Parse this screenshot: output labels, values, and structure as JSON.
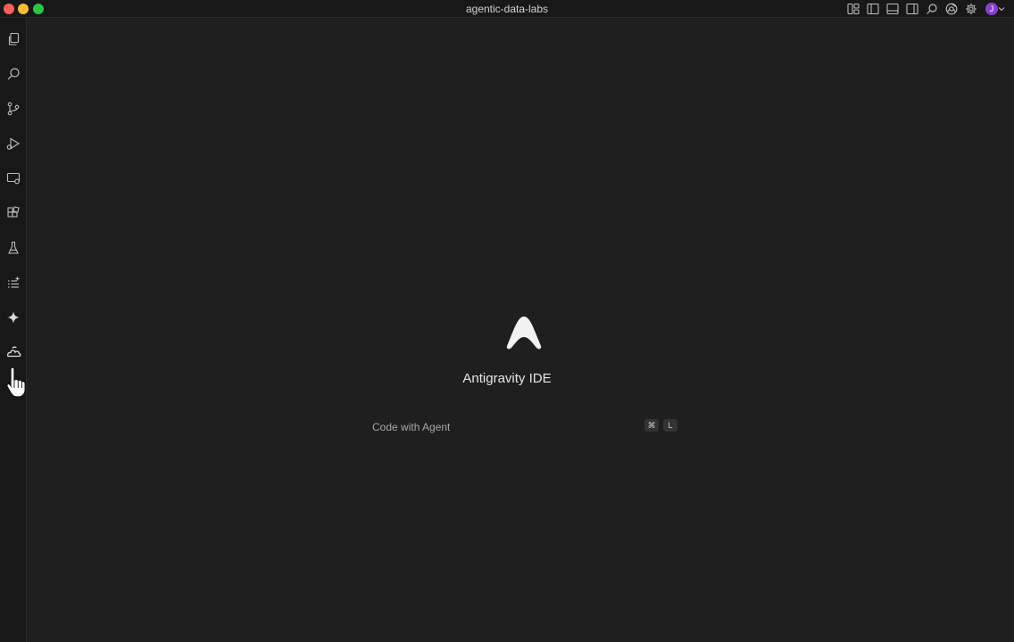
{
  "window": {
    "title": "agentic-data-labs"
  },
  "titlebar": {
    "icons": [
      "layout-icon",
      "toggle-sidebar-icon",
      "toggle-panel-icon",
      "toggle-secondary-sidebar-icon",
      "search-icon",
      "browser-icon",
      "settings-gear-icon",
      "account-avatar"
    ],
    "avatar_initial": "J"
  },
  "activitybar": {
    "items": [
      "explorer-icon",
      "search-icon",
      "source-control-icon",
      "run-debug-icon",
      "remote-explorer-icon",
      "extensions-icon",
      "testing-icon",
      "outline-list-icon",
      "agent-sparkle-icon",
      "cloud-deploy-icon"
    ]
  },
  "welcome": {
    "product_name": "Antigravity IDE",
    "command_label": "Code with Agent",
    "shortcut_keys": [
      "⌘",
      "L"
    ]
  },
  "colors": {
    "background": "#1f1f1f",
    "sidebar": "#181818",
    "accent_avatar": "#8a3bd4"
  }
}
